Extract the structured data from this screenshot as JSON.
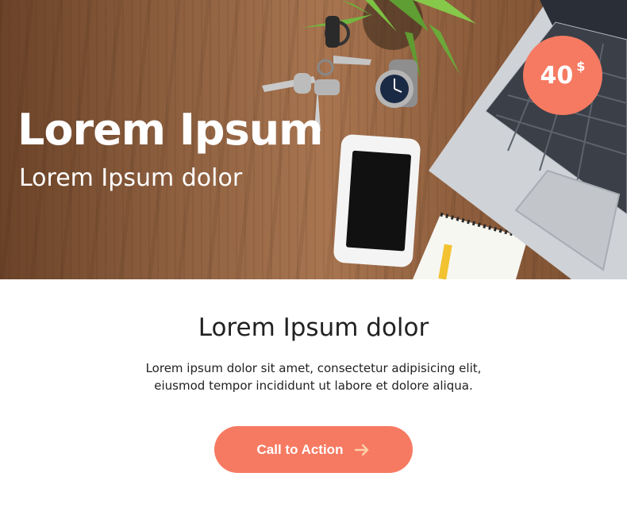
{
  "hero": {
    "title": "Lorem Ipsum",
    "subtitle": "Lorem Ipsum dolor",
    "price": {
      "amount": "40",
      "currency": "$"
    }
  },
  "content": {
    "title": "Lorem Ipsum dolor",
    "body_line1": "Lorem ipsum dolor sit amet, consectetur adipisicing elit,",
    "body_line2": "eiusmod tempor incididunt ut labore et dolore aliqua."
  },
  "cta": {
    "label": "Call to Action",
    "icon": "arrow-right-icon"
  },
  "colors": {
    "accent": "#f67a62",
    "text": "#222222",
    "arrow": "#ffd0a8"
  }
}
